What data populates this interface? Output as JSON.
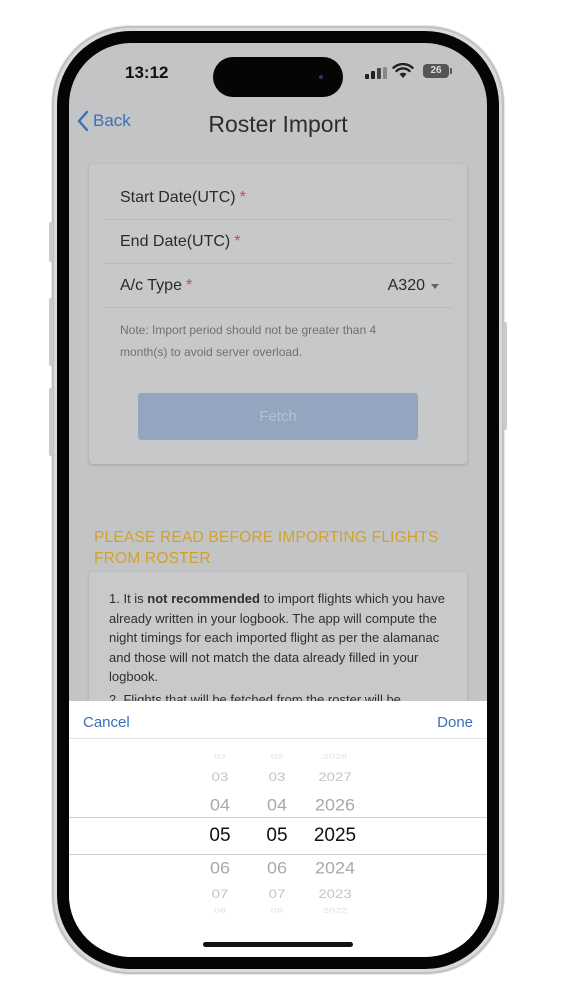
{
  "status": {
    "time": "13:12",
    "battery": "26"
  },
  "nav": {
    "back_label": "Back",
    "title": "Roster Import"
  },
  "form": {
    "start_date_label": "Start Date(UTC)",
    "end_date_label": "End Date(UTC)",
    "actype_label": "A/c Type",
    "required_mark": "*",
    "actype_value": "A320",
    "note": "Note: Import period should not be greater than 4 month(s) to avoid server overload.",
    "fetch_label": "Fetch"
  },
  "warning": {
    "title": "PLEASE READ BEFORE IMPORTING FLIGHTS FROM ROSTER",
    "p1_prefix": "1. It is ",
    "p1_bold": "not recommended",
    "p1_suffix": " to import flights which you have already written in your logbook. The app will compute the night timings for each imported flight as per the alamanac and those will not match the data already filled in your logbook.",
    "p2_partial": "2. Flights that will be fetched from the roster will be"
  },
  "picker": {
    "cancel_label": "Cancel",
    "done_label": "Done",
    "col1": [
      "02",
      "03",
      "04",
      "05",
      "06",
      "07",
      "08"
    ],
    "col2": [
      "02",
      "03",
      "04",
      "05",
      "06",
      "07",
      "08"
    ],
    "col3": [
      "2028",
      "2027",
      "2026",
      "2025",
      "2024",
      "2023",
      "2022"
    ],
    "selected_index": 3
  },
  "colors": {
    "accent": "#3d6fb6",
    "warning": "#d4a12a",
    "required": "#c0504d"
  }
}
